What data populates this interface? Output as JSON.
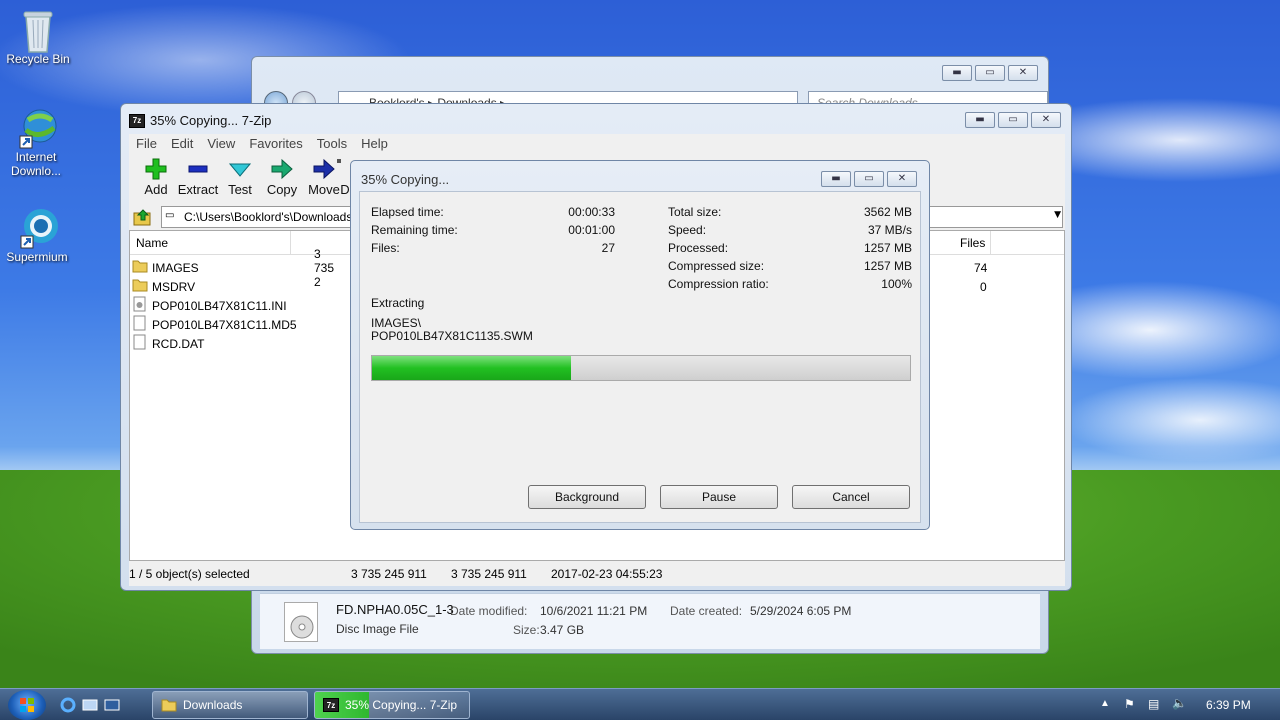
{
  "desktop": {
    "icons": [
      {
        "label": "Recycle Bin"
      },
      {
        "label": "Internet Downlo..."
      },
      {
        "label": "Supermium"
      }
    ]
  },
  "explorer": {
    "breadcrumb": "Booklord's  ▸  Downloads  ▸",
    "search_placeholder": "Search Downloads",
    "details": {
      "file_name": "FD.NPHA0.05C_1-3",
      "file_type": "Disc Image File",
      "date_modified_label": "Date modified:",
      "date_modified": "10/6/2021 11:21 PM",
      "date_created_label": "Date created:",
      "date_created": "5/29/2024 6:05 PM",
      "size_label": "Size:",
      "size": "3.47 GB"
    }
  },
  "zip": {
    "title": "35% Copying... 7-Zip",
    "menu": [
      "File",
      "Edit",
      "View",
      "Favorites",
      "Tools",
      "Help"
    ],
    "toolbar": [
      {
        "label": "Add",
        "icon": "plus-icon"
      },
      {
        "label": "Extract",
        "icon": "minus-icon"
      },
      {
        "label": "Test",
        "icon": "check-icon"
      },
      {
        "label": "Copy",
        "icon": "copy-arrow-icon"
      },
      {
        "label": "Move",
        "icon": "move-arrow-icon"
      },
      {
        "label": "D",
        "icon": "delete-icon"
      }
    ],
    "path": "C:\\Users\\Booklord's\\Downloads",
    "columns": {
      "name": "Name",
      "files": "Files"
    },
    "rows": [
      {
        "name": "IMAGES",
        "size": "3 735 2",
        "files": "74",
        "icon": "folder-icon"
      },
      {
        "name": "MSDRV",
        "size": "",
        "files": "0",
        "icon": "folder-icon"
      },
      {
        "name": "POP010LB47X81C11.INI",
        "size": "",
        "files": "",
        "icon": "settings-file-icon"
      },
      {
        "name": "POP010LB47X81C11.MD5",
        "size": "",
        "files": "",
        "icon": "file-icon"
      },
      {
        "name": "RCD.DAT",
        "size": "",
        "files": "",
        "icon": "file-icon"
      }
    ],
    "status": {
      "selection": "1 / 5 object(s) selected",
      "size": "3 735 245 911",
      "packed": "3 735 245 911",
      "modified": "2017-02-23 04:55:23"
    }
  },
  "dialog": {
    "title": "35% Copying...",
    "elapsed_label": "Elapsed time:",
    "elapsed": "00:00:33",
    "remaining_label": "Remaining time:",
    "remaining": "00:01:00",
    "files_label": "Files:",
    "files": "27",
    "total_label": "Total size:",
    "total": "3562 MB",
    "speed_label": "Speed:",
    "speed": "37 MB/s",
    "processed_label": "Processed:",
    "processed": "1257 MB",
    "compressed_label": "Compressed size:",
    "compressed": "1257 MB",
    "ratio_label": "Compression ratio:",
    "ratio": "100%",
    "action": "Extracting",
    "path_line1": "IMAGES\\",
    "path_line2": "POP010LB47X81C1135.SWM",
    "progress": 0.37,
    "buttons": {
      "background": "Background",
      "pause": "Pause",
      "cancel": "Cancel"
    }
  },
  "taskbar": {
    "items": [
      {
        "label": "Downloads"
      },
      {
        "label": "35% Copying... 7-Zip"
      }
    ],
    "clock": "6:39 PM"
  }
}
